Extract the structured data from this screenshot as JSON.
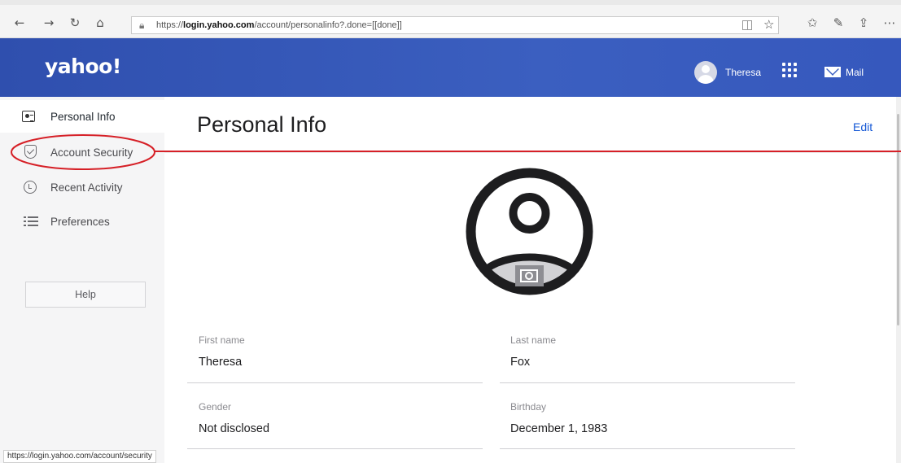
{
  "browser": {
    "url_prefix": "https://",
    "url_host": "login.yahoo.com",
    "url_rest": "/account/personalinfo?.done=[[done]]",
    "status_url": "https://login.yahoo.com/account/security"
  },
  "header": {
    "logo": "yahoo!",
    "user_name": "Theresa",
    "mail_label": "Mail"
  },
  "sidebar": {
    "items": [
      {
        "label": "Personal Info"
      },
      {
        "label": "Account Security"
      },
      {
        "label": "Recent Activity"
      },
      {
        "label": "Preferences"
      }
    ],
    "help_label": "Help"
  },
  "main": {
    "title": "Personal Info",
    "edit_label": "Edit",
    "fields": {
      "first_name_label": "First name",
      "first_name_value": "Theresa",
      "last_name_label": "Last name",
      "last_name_value": "Fox",
      "gender_label": "Gender",
      "gender_value": "Not disclosed",
      "birthday_label": "Birthday",
      "birthday_value": "December 1, 1983"
    }
  },
  "colors": {
    "header_blue": "#3b5fc0",
    "link_blue": "#1558d6",
    "annotation_red": "#d62027"
  }
}
